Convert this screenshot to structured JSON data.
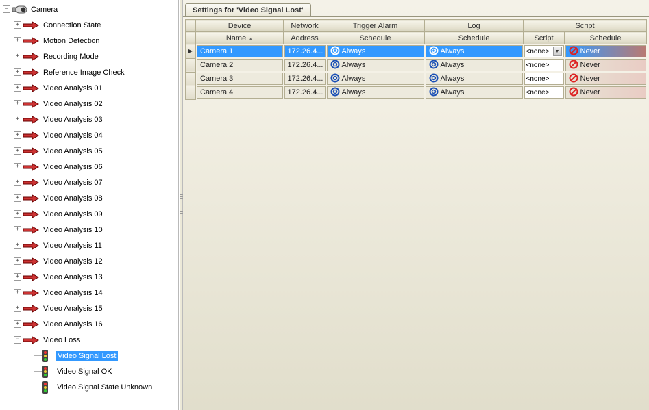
{
  "tree": {
    "root": "Camera",
    "items": [
      "Connection State",
      "Motion Detection",
      "Recording Mode",
      "Reference Image Check",
      "Video Analysis 01",
      "Video Analysis 02",
      "Video Analysis 03",
      "Video Analysis 04",
      "Video Analysis 05",
      "Video Analysis 06",
      "Video Analysis 07",
      "Video Analysis 08",
      "Video Analysis 09",
      "Video Analysis 10",
      "Video Analysis 11",
      "Video Analysis 12",
      "Video Analysis 13",
      "Video Analysis 14",
      "Video Analysis 15",
      "Video Analysis 16"
    ],
    "videoloss_label": "Video Loss",
    "videoloss_children": [
      "Video Signal Lost",
      "Video Signal OK",
      "Video Signal State Unknown"
    ],
    "selected": "Video Signal Lost"
  },
  "tab_title": "Settings for 'Video Signal Lost'",
  "columns": {
    "group_device": "Device",
    "group_network": "Network",
    "group_trigger": "Trigger Alarm",
    "group_log": "Log",
    "group_script": "Script",
    "name": "Name",
    "address": "Address",
    "schedule": "Schedule",
    "script": "Script"
  },
  "rows": [
    {
      "name": "Camera 1",
      "address": "172.26.4...",
      "trigger": "Always",
      "log": "Always",
      "script": "<none>",
      "script_schedule": "Never",
      "selected": true
    },
    {
      "name": "Camera 2",
      "address": "172.26.4...",
      "trigger": "Always",
      "log": "Always",
      "script": "<none>",
      "script_schedule": "Never",
      "selected": false
    },
    {
      "name": "Camera 3",
      "address": "172.26.4...",
      "trigger": "Always",
      "log": "Always",
      "script": "<none>",
      "script_schedule": "Never",
      "selected": false
    },
    {
      "name": "Camera 4",
      "address": "172.26.4...",
      "trigger": "Always",
      "log": "Always",
      "script": "<none>",
      "script_schedule": "Never",
      "selected": false
    }
  ]
}
